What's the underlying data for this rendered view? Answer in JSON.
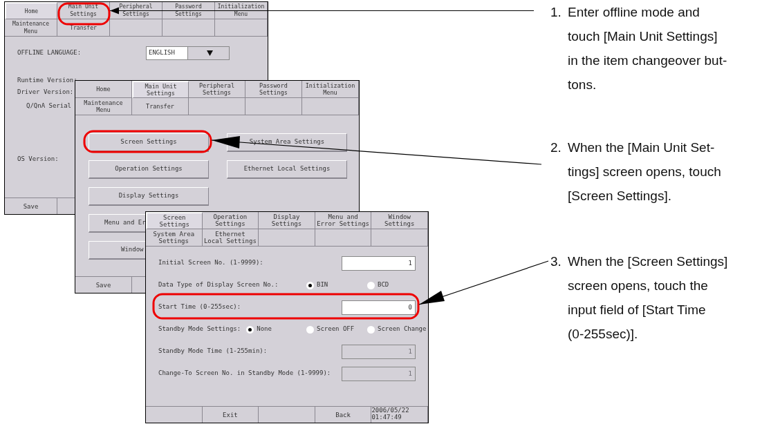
{
  "offline_screen": {
    "tabs": [
      {
        "label": "Home",
        "selected": true
      },
      {
        "label": "Main Unit\nSettings",
        "selected": false
      },
      {
        "label": "Peripheral\nSettings",
        "selected": false
      },
      {
        "label": "Password\nSettings",
        "selected": false
      },
      {
        "label": "Initialization\nMenu",
        "selected": false
      }
    ],
    "tabs_row2": [
      {
        "label": "Maintenance\nMenu",
        "selected": false
      },
      {
        "label": "Transfer",
        "selected": false
      }
    ],
    "language": {
      "label": "OFFLINE LANGUAGE:",
      "value": "ENGLISH"
    },
    "info_labels": [
      "Runtime Version:",
      "Driver Version:",
      "Q/QnA Serial",
      "OS Version:"
    ],
    "footer": [
      "Save"
    ]
  },
  "main_unit_screen": {
    "tabs": [
      {
        "label": "Home",
        "selected": false
      },
      {
        "label": "Main Unit\nSettings",
        "selected": true
      },
      {
        "label": "Peripheral\nSettings",
        "selected": false
      },
      {
        "label": "Password\nSettings",
        "selected": false
      },
      {
        "label": "Initialization\nMenu",
        "selected": false
      }
    ],
    "tabs_row2": [
      {
        "label": "Maintenance\nMenu",
        "selected": false
      },
      {
        "label": "Transfer",
        "selected": false
      }
    ],
    "button_rows": [
      [
        {
          "label": "Screen Settings",
          "partly_covered": false
        },
        {
          "label": "System Area Settings",
          "partly_covered": false
        }
      ],
      [
        {
          "label": "Operation Settings",
          "partly_covered": false
        },
        {
          "label": "Ethernet Local Settings",
          "partly_covered": false
        }
      ],
      [
        {
          "label": "Display Settings",
          "partly_covered": false
        }
      ],
      [
        {
          "label": "Menu and Er",
          "partly_covered": true
        }
      ],
      [
        {
          "label": "Window",
          "partly_covered": true
        }
      ]
    ],
    "footer": [
      "Save"
    ]
  },
  "screen_settings_screen": {
    "tabs": [
      {
        "label": "Screen\nSettings",
        "selected": true
      },
      {
        "label": "Operation\nSettings",
        "selected": false
      },
      {
        "label": "Display\nSettings",
        "selected": false
      },
      {
        "label": "Menu and\nError Settings",
        "selected": false
      },
      {
        "label": "Window\nSettings",
        "selected": false
      }
    ],
    "tabs_row2": [
      {
        "label": "System Area\nSettings",
        "selected": false
      },
      {
        "label": "Ethernet\nLocal Settings",
        "selected": false
      }
    ],
    "settings": [
      {
        "kind": "input",
        "label": "Initial Screen No. (1-9999):",
        "value": "1",
        "disabled": false
      },
      {
        "kind": "radio",
        "label": "Data Type of Display Screen No.:",
        "options": [
          {
            "label": "BIN",
            "selected": true
          },
          {
            "label": "BCD",
            "selected": false
          }
        ]
      },
      {
        "kind": "input",
        "label": "Start Time (0-255sec):",
        "value": "0",
        "disabled": false
      },
      {
        "kind": "radio",
        "label": "Standby Mode Settings:",
        "options": [
          {
            "label": "None",
            "selected": true
          },
          {
            "label": "Screen OFF",
            "selected": false
          },
          {
            "label": "Screen Change",
            "selected": false
          }
        ]
      },
      {
        "kind": "input",
        "label": "Standby Mode Time (1-255min):",
        "value": "1",
        "disabled": true
      },
      {
        "kind": "input",
        "label": "Change-To Screen No. in Standby Mode (1-9999):",
        "value": "1",
        "disabled": true
      }
    ],
    "footer": {
      "exit": "Exit",
      "back": "Back",
      "datetime": "2006/05/22\n01:47:49"
    }
  },
  "steps": [
    {
      "number": "1.",
      "lines": [
        "Enter offline mode and",
        "touch [Main Unit Settings]",
        "in the item changeover but-",
        "tons."
      ]
    },
    {
      "number": "2.",
      "lines": [
        "When the [Main Unit Set-",
        "tings] screen opens, touch",
        "[Screen Settings]."
      ]
    },
    {
      "number": "3.",
      "lines": [
        "When the [Screen Settings]",
        "screen opens, touch the",
        "input field of [Start Time",
        "(0-255sec)]."
      ]
    }
  ]
}
